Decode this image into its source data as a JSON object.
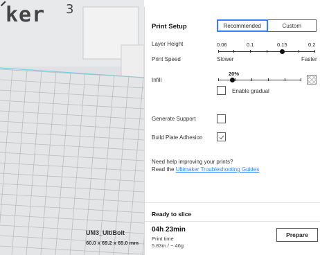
{
  "viewport": {
    "brand_text": "ker",
    "brand_superscript": "3",
    "model_name": "UM3_UltiBolt",
    "model_dimensions": "60.0 x 69.2 x 65.0 mm",
    "edit_icon": "pencil-icon"
  },
  "print_setup": {
    "title": "Print Setup",
    "modes": [
      {
        "label": "Recommended",
        "active": true
      },
      {
        "label": "Custom",
        "active": false
      }
    ],
    "layer_height": {
      "label": "Layer Height",
      "values": [
        "0.06",
        "0.1",
        "0.15",
        "0.2"
      ],
      "selected": "0.15"
    },
    "print_speed": {
      "label": "Print Speed",
      "slower_label": "Slower",
      "faster_label": "Faster"
    },
    "infill": {
      "label": "Infill",
      "value_label": "20%",
      "percent": 20,
      "icon": "infill-pattern-icon"
    },
    "enable_gradual": {
      "label": "Enable gradual",
      "checked": false
    },
    "generate_support": {
      "label": "Generate Support",
      "checked": false
    },
    "build_plate_adhesion": {
      "label": "Build Plate Adhesion",
      "checked": true
    },
    "help": {
      "line1": "Need help improving your prints?",
      "line2_prefix": "Read the ",
      "link_text": "Ultimaker Troubleshooting Guides"
    }
  },
  "slice": {
    "status_title": "Ready to slice",
    "time_value": "04h 23min",
    "time_label": "Print time",
    "material": "5.83m / ~ 46g",
    "prepare_label": "Prepare"
  },
  "colors": {
    "accent": "#3282ff",
    "viewport_bg": "#dfe1e4",
    "grid_line": "#b9bbbe"
  }
}
